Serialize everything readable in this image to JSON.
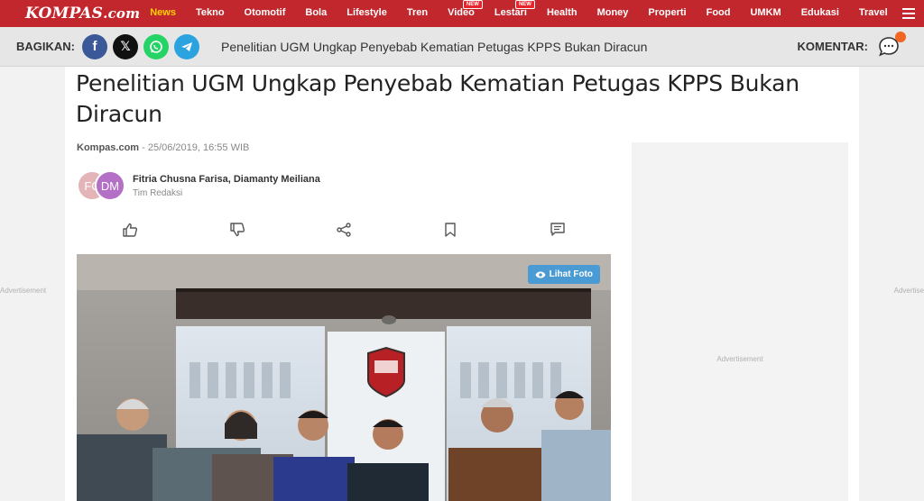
{
  "brand": {
    "logo_text": "KOMPAS",
    "logo_suffix": ".com"
  },
  "nav": {
    "items": [
      {
        "label": "News",
        "active": true,
        "badge": ""
      },
      {
        "label": "Tekno",
        "active": false,
        "badge": ""
      },
      {
        "label": "Otomotif",
        "active": false,
        "badge": ""
      },
      {
        "label": "Bola",
        "active": false,
        "badge": ""
      },
      {
        "label": "Lifestyle",
        "active": false,
        "badge": ""
      },
      {
        "label": "Tren",
        "active": false,
        "badge": ""
      },
      {
        "label": "Video",
        "active": false,
        "badge": "NEW"
      },
      {
        "label": "Lestari",
        "active": false,
        "badge": "NEW"
      },
      {
        "label": "Health",
        "active": false,
        "badge": ""
      },
      {
        "label": "Money",
        "active": false,
        "badge": ""
      },
      {
        "label": "Properti",
        "active": false,
        "badge": ""
      },
      {
        "label": "Food",
        "active": false,
        "badge": ""
      },
      {
        "label": "UMKM",
        "active": false,
        "badge": ""
      },
      {
        "label": "Edukasi",
        "active": false,
        "badge": ""
      },
      {
        "label": "Travel",
        "active": false,
        "badge": ""
      }
    ],
    "menu_icon": "hamburger-icon"
  },
  "sharebar": {
    "label": "BAGIKAN:",
    "buttons": [
      {
        "name": "facebook",
        "glyph": "f"
      },
      {
        "name": "x",
        "glyph": "𝕏"
      },
      {
        "name": "whatsapp",
        "glyph": ""
      },
      {
        "name": "telegram",
        "glyph": ""
      }
    ],
    "title": "Penelitian UGM Ungkap Penyebab Kematian Petugas KPPS Bukan Diracun",
    "komentar_label": "KOMENTAR:"
  },
  "article": {
    "headline": "Penelitian UGM Ungkap Penyebab Kematian Petugas KPPS Bukan Diracun",
    "source": "Kompas.com",
    "date": " - 25/06/2019, 16:55 WIB",
    "authors": [
      {
        "initials": "FC"
      },
      {
        "initials": "DM"
      }
    ],
    "author_names": "Fitria Chusna Farisa, Diamanty Meiliana",
    "author_role": "Tim Redaksi",
    "actions": [
      "like-icon",
      "dislike-icon",
      "share-icon",
      "bookmark-icon",
      "comment-icon"
    ],
    "photo_button": "Lihat Foto"
  },
  "ads": {
    "left": "Advertisement",
    "right": "Advertise",
    "sidebar": "Advertisement"
  },
  "colors": {
    "brand_red": "#c1272d",
    "active_nav": "#ffd200",
    "photo_btn": "#4a9ad4"
  }
}
